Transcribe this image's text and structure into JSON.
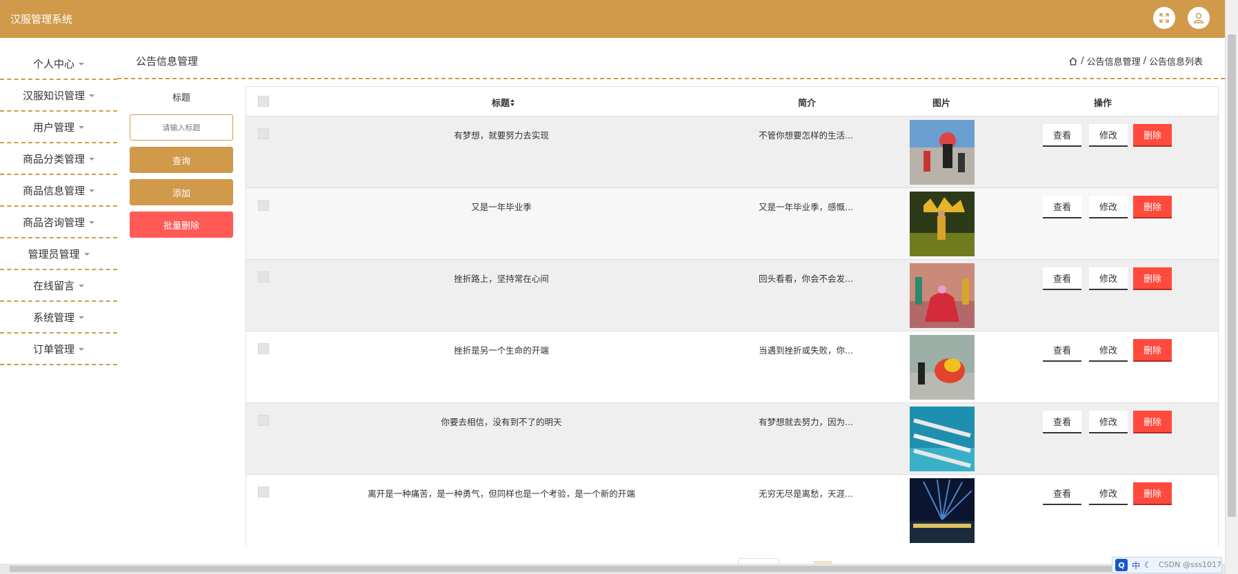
{
  "app": {
    "title": "汉服管理系统"
  },
  "header": {
    "fullscreen_icon": "fullscreen-icon",
    "user_icon": "user-icon"
  },
  "sidebar": {
    "items": [
      {
        "label": "个人中心"
      },
      {
        "label": "汉服知识管理"
      },
      {
        "label": "用户管理"
      },
      {
        "label": "商品分类管理"
      },
      {
        "label": "商品信息管理"
      },
      {
        "label": "商品咨询管理"
      },
      {
        "label": "管理员管理"
      },
      {
        "label": "在线留言"
      },
      {
        "label": "系统管理"
      },
      {
        "label": "订单管理"
      }
    ]
  },
  "page": {
    "title": "公告信息管理",
    "breadcrumb": [
      "公告信息管理",
      "公告信息列表"
    ],
    "breadcrumb_sep": "/"
  },
  "search": {
    "label": "标题",
    "placeholder": "请输入标题",
    "query_label": "查询",
    "add_label": "添加",
    "batch_delete_label": "批量删除"
  },
  "table": {
    "headers": {
      "title": "标题",
      "sort_icon": "sort-icon",
      "intro": "简介",
      "image": "图片",
      "actions": "操作"
    },
    "action_labels": {
      "view": "查看",
      "edit": "修改",
      "delete": "删除"
    },
    "rows": [
      {
        "title": "有梦想，就要努力去实现",
        "intro": "不管你想要怎样的生活...",
        "image": "photo-dancers-parade"
      },
      {
        "title": "又是一年毕业季",
        "intro": "又是一年毕业季，感慨...",
        "image": "photo-festival-dancer"
      },
      {
        "title": "挫折路上，坚持常在心间",
        "intro": "回头看看，你会不会发...",
        "image": "photo-red-dress-dance"
      },
      {
        "title": "挫折是另一个生命的开端",
        "intro": "当遇到挫折或失败，你...",
        "image": "photo-lion-dance"
      },
      {
        "title": "你要去相信，没有到不了的明天",
        "intro": "有梦想就去努力，因为...",
        "image": "photo-dragon-boat"
      },
      {
        "title": "离开是一种痛苦，是一种勇气，但同样也是一个考验，是一个新的开端",
        "intro": "无穷无尽是离愁，天涯...",
        "image": "photo-night-lights"
      }
    ]
  },
  "ime": {
    "logo": "Q",
    "mode": "中"
  },
  "watermark": "CSDN @sss1017"
}
